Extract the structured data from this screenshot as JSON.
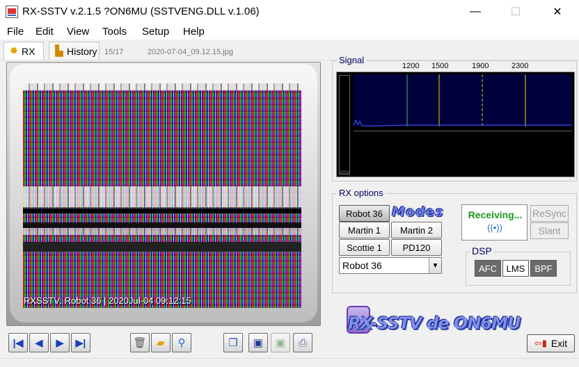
{
  "window": {
    "title": "RX-SSTV v.2.1.5 ?ON6MU (SSTVENG.DLL v.1.06)",
    "minimize": "—",
    "maximize": "☐",
    "close": "✕"
  },
  "menu": [
    "File",
    "Edit",
    "View",
    "Tools",
    "Setup",
    "Help"
  ],
  "tabs": [
    {
      "label": "RX",
      "icon": "gear-icon",
      "active": true
    },
    {
      "label": "History",
      "icon": "image-icon",
      "active": false
    }
  ],
  "history": {
    "counter": "15/17",
    "filename": "2020-07-04_09.12.15.jpg"
  },
  "image_caption": "RXSSTV: Robot 36 | 2020Jul-04 09:12:15",
  "signal": {
    "label": "Signal",
    "freqs": [
      "1200",
      "1500",
      "1900",
      "2300"
    ],
    "line_colors": {
      "1200": "#33cc33",
      "1500": "#e8d800",
      "1900": "#e8d800",
      "2300": "#e8d800"
    }
  },
  "rx_options": {
    "label": "RX options",
    "modes_logo": "Modes",
    "buttons": [
      "Robot 36",
      "Martin 1",
      "Martin 2",
      "Scottie 1",
      "PD120"
    ],
    "selected_mode": "Robot 36",
    "status": "Receiving...",
    "resync": "ReSync",
    "slant": "Slant"
  },
  "dsp": {
    "label": "DSP",
    "afc": "AFC",
    "lms": "LMS",
    "bpf": "BPF"
  },
  "logo_text": "RX-SSTV de ON6MU",
  "exit_label": "Exit"
}
